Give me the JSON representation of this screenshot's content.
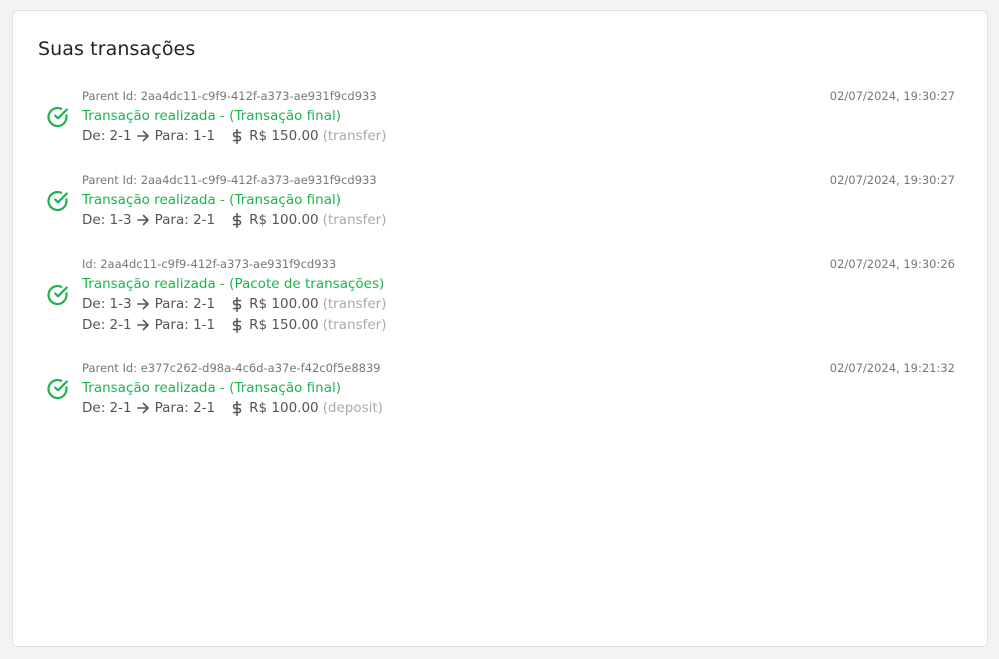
{
  "page": {
    "title": "Suas transações"
  },
  "colors": {
    "success": "#1db34d",
    "muted": "#777777",
    "text": "#555555",
    "kind": "#aaaaaa"
  },
  "transactions": [
    {
      "meta": "Parent Id: 2aa4dc11-c9f9-412f-a373-ae931f9cd933",
      "date": "02/07/2024, 19:30:27",
      "title": "Transação realizada - (Transação final)",
      "icon": "check-circle-icon",
      "lines": [
        {
          "from": "De: 2-1",
          "to": "Para: 1-1",
          "amount": "R$ 150.00",
          "kind": "(transfer)"
        }
      ]
    },
    {
      "meta": "Parent Id: 2aa4dc11-c9f9-412f-a373-ae931f9cd933",
      "date": "02/07/2024, 19:30:27",
      "title": "Transação realizada - (Transação final)",
      "icon": "check-circle-icon",
      "lines": [
        {
          "from": "De: 1-3",
          "to": "Para: 2-1",
          "amount": "R$ 100.00",
          "kind": "(transfer)"
        }
      ]
    },
    {
      "meta": "Id: 2aa4dc11-c9f9-412f-a373-ae931f9cd933",
      "date": "02/07/2024, 19:30:26",
      "title": "Transação realizada - (Pacote de transações)",
      "icon": "check-circle-icon",
      "lines": [
        {
          "from": "De: 1-3",
          "to": "Para: 2-1",
          "amount": "R$ 100.00",
          "kind": "(transfer)"
        },
        {
          "from": "De: 2-1",
          "to": "Para: 1-1",
          "amount": "R$ 150.00",
          "kind": "(transfer)"
        }
      ]
    },
    {
      "meta": "Parent Id: e377c262-d98a-4c6d-a37e-f42c0f5e8839",
      "date": "02/07/2024, 19:21:32",
      "title": "Transação realizada - (Transação final)",
      "icon": "check-circle-icon",
      "lines": [
        {
          "from": "De: 2-1",
          "to": "Para: 2-1",
          "amount": "R$ 100.00",
          "kind": "(deposit)"
        }
      ]
    }
  ]
}
